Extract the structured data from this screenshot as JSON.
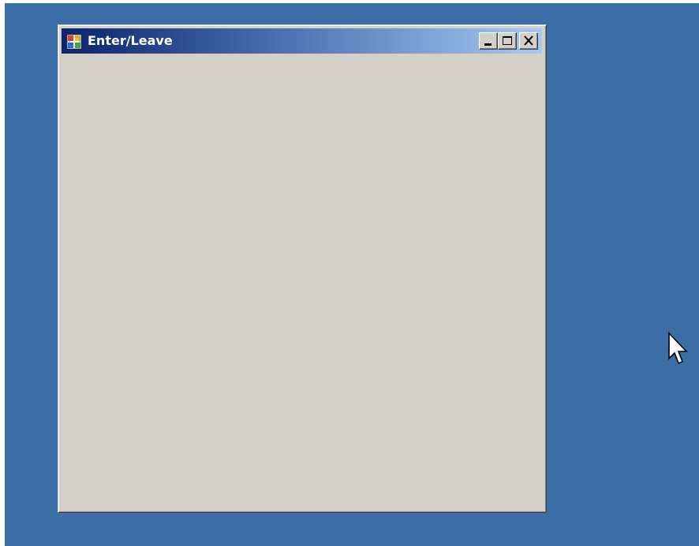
{
  "desktop": {
    "background_color": "#3a6ea5"
  },
  "window": {
    "title": "Enter/Leave",
    "icon": "windows-form-icon",
    "client_color": "#d4d0c8",
    "titlebar_gradient": [
      "#0a246a",
      "#a6caf0"
    ],
    "caption_buttons": [
      {
        "name": "minimize",
        "icon": "minimize-icon"
      },
      {
        "name": "maximize",
        "icon": "maximize-icon"
      },
      {
        "name": "close",
        "icon": "close-icon"
      }
    ]
  },
  "cursor": {
    "icon": "arrow-cursor-icon"
  }
}
